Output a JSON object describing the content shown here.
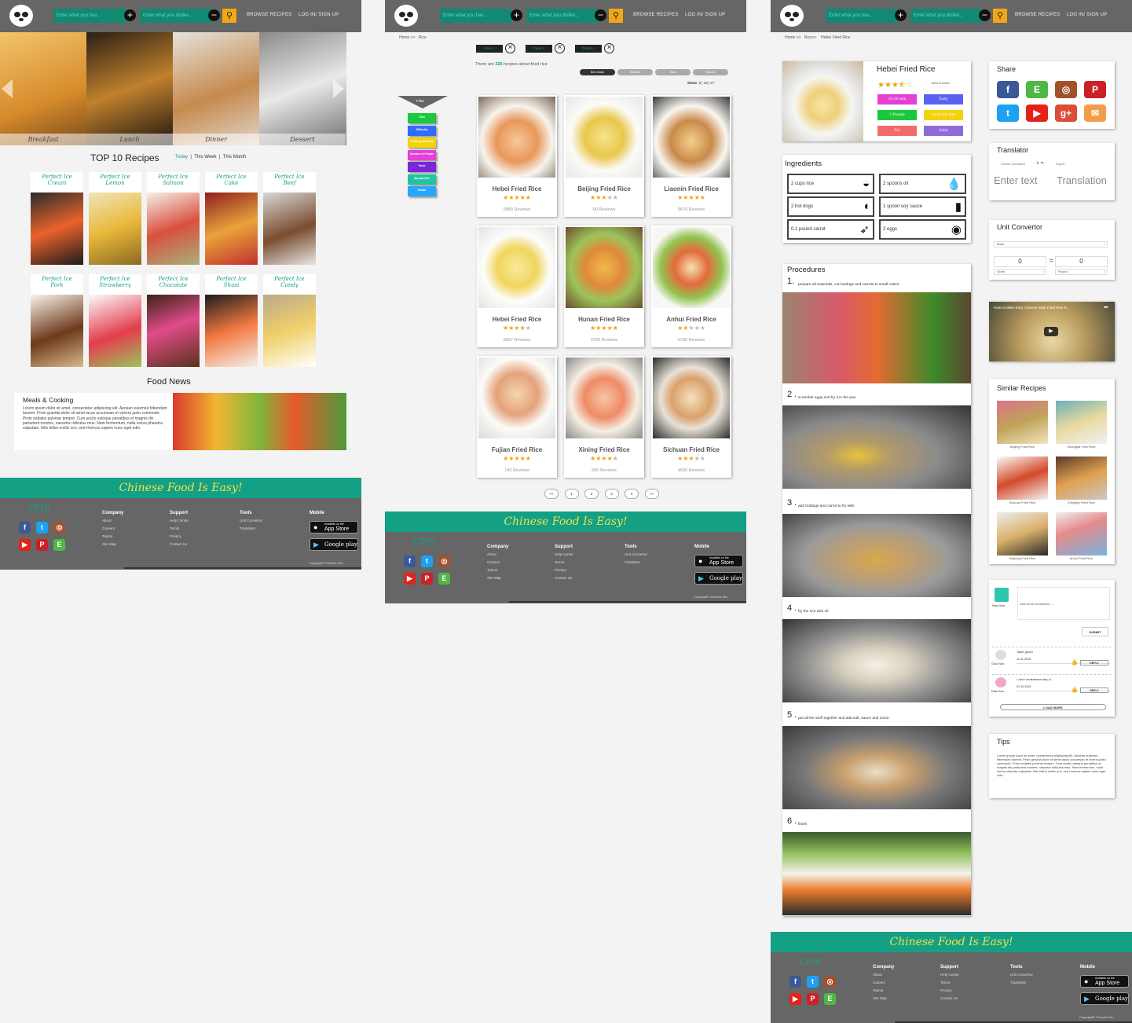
{
  "header": {
    "search_placeholder_1": "Enter what you hav...",
    "search_placeholder_2": "Enter what you dislike...",
    "add_symbol": "+",
    "remove_symbol": "−",
    "search_symbol": "🔍",
    "browse_label": "BROWSE RECIPES",
    "login_label": "LOG IN/ SIGN UP"
  },
  "home": {
    "slides": [
      "Breakfast",
      "Lunch",
      "Dinner",
      "Dessert"
    ],
    "top_title": "TOP 10 Recipes",
    "filters": [
      "Today",
      "This Week",
      "This Month"
    ],
    "top_recipes": [
      {
        "line1": "Perfect Ice",
        "line2": "Cream"
      },
      {
        "line1": "Perfect Ice",
        "line2": "Lemon"
      },
      {
        "line1": "Perfect Ice",
        "line2": "Salmon"
      },
      {
        "line1": "Perfect Ice",
        "line2": "Cake"
      },
      {
        "line1": "Perfect Ice",
        "line2": "Beef"
      },
      {
        "line1": "Perfect Ice",
        "line2": "Pork"
      },
      {
        "line1": "Perfect Ice",
        "line2": "Strawberry"
      },
      {
        "line1": "Perfect Ice",
        "line2": "Chocolate"
      },
      {
        "line1": "Perfect Ice",
        "line2": "Shusi"
      },
      {
        "line1": "Perfect Ice",
        "line2": "Candy"
      }
    ],
    "news_title": "Food News",
    "news_heading": "Meals & Cooking",
    "news_body": "Lorem ipsum dolor sit amet, consectetur adipiscing elit. Aenean euismod bibendum laoreet. Proin gravida dolor sit amet lacus accumsan et viverra justo commodo. Proin sodales pulvinar tempor. Cum sociis natoque penatibus et magnis dis parturient montes, nascetur ridiculus mus. Nam fermentum, nulla luctus pharetra vulputate, felis tellus mollis orci, sed rhoncus sapien nunc eget odio."
  },
  "footer": {
    "slogan": "Chinese Food Is Easy!",
    "logo_text": "CFIE",
    "columns": [
      {
        "title": "Company",
        "items": [
          "About",
          "Careers",
          "Teams",
          "Site Map"
        ]
      },
      {
        "title": "Support",
        "items": [
          "Help Center",
          "Terms",
          "Privacy",
          "Contact Us"
        ]
      },
      {
        "title": "Tools",
        "items": [
          "Unit Convertor",
          "Translator"
        ]
      },
      {
        "title": "Mobile",
        "items": []
      }
    ],
    "app_store": "App Store",
    "app_store_small": "Available on the",
    "google_play": "Google play",
    "copyright": "Copyright© Zhenzhi Zhu",
    "social_icons": [
      "facebook-icon",
      "twitter-icon",
      "instagram-icon",
      "youtube-icon",
      "pinterest-icon",
      "evernote-icon"
    ]
  },
  "list": {
    "breadcrumb": "Home >>   Rice",
    "tags": [
      "Rice ×",
      "Fried ×",
      "Onion ×"
    ],
    "result_prefix": "There are ",
    "result_count": "326",
    "result_suffix": " recipes about fried rice",
    "sort_buttons": [
      "Best Match",
      "Reviews",
      "Rate",
      "Newest"
    ],
    "show_label": "Show",
    "show_options": "9 | 18 | 27",
    "filter_label": "Filter",
    "filter_items": [
      {
        "label": "Time",
        "color": "#19c93b"
      },
      {
        "label": "Difficulty",
        "color": "#2f6bff"
      },
      {
        "label": "Cooking Methods",
        "color": "#f4d20a"
      },
      {
        "label": "Number of People",
        "color": "#e53fd6"
      },
      {
        "label": "Taste",
        "color": "#7a26d9"
      },
      {
        "label": "Special Diet",
        "color": "#21c3a2"
      },
      {
        "label": "Health",
        "color": "#27a7ff"
      }
    ],
    "recipes": [
      {
        "name": "Hebei Fried Rice",
        "rating": 5,
        "reviews": "9980 Reviews"
      },
      {
        "name": "Beijing Fried Rice",
        "rating": 3,
        "reviews": "90 Reviews"
      },
      {
        "name": "Liaonin Fried Rice",
        "rating": 5,
        "reviews": "9670 Reviews"
      },
      {
        "name": "Hebei Fried Rice",
        "rating": 4,
        "reviews": "9967 Reviews"
      },
      {
        "name": "Hunan Fried Rice",
        "rating": 5,
        "reviews": "9780 Reviews"
      },
      {
        "name": "Anhui Fried Rice",
        "rating": 2,
        "reviews": "6780 Reviews"
      },
      {
        "name": "Fujian Fried Rice",
        "rating": 5,
        "reviews": "140 Reviews"
      },
      {
        "name": "Xining Fried Rice",
        "rating": 4,
        "reviews": "680 Reviews"
      },
      {
        "name": "Sichuan Fried Rice",
        "rating": 3,
        "reviews": "4580 Reviews"
      }
    ],
    "pagination": [
      "<<",
      "1",
      "2",
      "3",
      "4",
      ">>"
    ]
  },
  "detail": {
    "breadcrumb": "Home >>   Rice>>    Hebei Fried Rice",
    "title": "Hebei Fried Rice",
    "rating": 3.5,
    "reviews": "1854 reviews",
    "chips": [
      {
        "label": "10-20 min",
        "color": "#e53fd6"
      },
      {
        "label": "Easy",
        "color": "#5a63f0"
      },
      {
        "label": "2 People",
        "color": "#19c93b"
      },
      {
        "label": "Good for diet",
        "color": "#f4d20a"
      },
      {
        "label": "Fry",
        "color": "#f26b6b"
      },
      {
        "label": "Salty",
        "color": "#8f6bd9"
      }
    ],
    "ingredients_title": "Ingredients",
    "ingredients": [
      "2 cups rice",
      "2 spoons  oil",
      "2 hot dogs",
      "1 spoon soy sauce",
      "0.1 pound carrot",
      "2 eggs"
    ],
    "procedures_title": "Procedures",
    "steps": [
      {
        "num": "1.",
        "text": "prepare all materials, cut hotdogs and carrots to small cubes."
      },
      {
        "num": "2 .",
        "text": "scramble eggs and fry it in the pan."
      },
      {
        "num": "3 .",
        "text": "add hotdogs and carrot to fry with."
      },
      {
        "num": "4 .",
        "text": "fry the rice with oil."
      },
      {
        "num": "5 .",
        "text": "put all the stuff together and add salt,  sauce and onion."
      },
      {
        "num": "6 .",
        "text": "finish"
      }
    ],
    "share_title": "Share",
    "share_icons": [
      "facebook-icon",
      "evernote-icon",
      "instagram-icon",
      "pinterest-icon",
      "twitter-icon",
      "youtube-icon",
      "google-plus-icon",
      "email-icon"
    ],
    "translator_title": "Translator",
    "translator_from": "Chinese (Simplified)",
    "translator_to": "English",
    "translator_input": "Enter text",
    "translator_output": "Translation",
    "unit_title": "Unit Convertor",
    "unit_type": "Mass",
    "unit_left_value": "0",
    "unit_right_value": "0",
    "unit_equals": "=",
    "unit_left": "Gram",
    "unit_right": "Pound",
    "video_title": "How to Make Easy Chinese Style Fried Rice R...",
    "similar_title": "Similar Recipes",
    "similar": [
      "Beijing Fried Rice",
      "Shanghai Fried Rice",
      "Sichuan Fried Rice",
      "Zhejiang Fried Rice",
      "Xinjiang Fried Rice",
      "Anhui Fried Rice"
    ],
    "comment_user": "New User",
    "comment_placeholder": "Add some comments......",
    "submit_label": "SUBMIT",
    "comments": [
      {
        "user": "Gulu Twin",
        "text": "Taste good!",
        "date": "10-11-2015",
        "reply": "REPLY"
      },
      {
        "user": "Dala Gulu",
        "text": "I don't understand step 4.",
        "date": "01-10-2015",
        "reply": "REPLY"
      }
    ],
    "load_more": "LOAD MORE",
    "tips_title": "Tips",
    "tips_body": "Lorem ipsum dolor sit amet, consectetur adipiscing elit. Aenean euismod bibendum laoreet. Proin gravida dolor sit amet lacus accumsan et viverra justo commodo. Proin sodales pulvinar tempor. Cum sociis natoque penatibus et magnis dis parturient montes, nascetur ridiculus mus. Nam fermentum, nulla luctus pharetra vulputate, felis tellus mollis orci, sed rhoncus sapien nunc eget odio."
  }
}
